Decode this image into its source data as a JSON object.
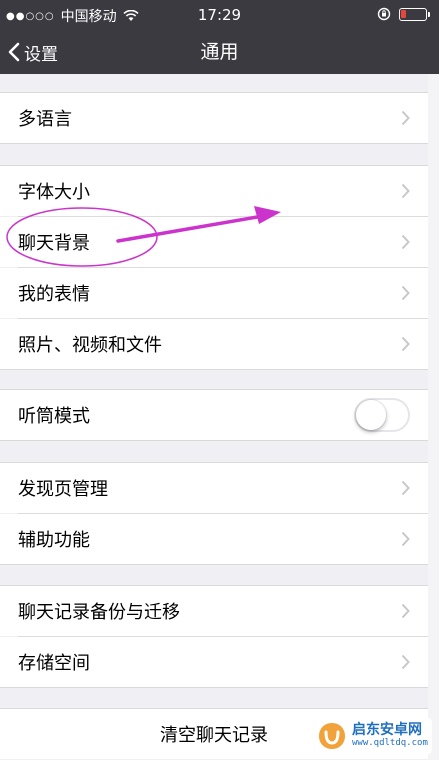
{
  "status_bar": {
    "signal": "●●○○○",
    "carrier": "中国移动",
    "time": "17:29"
  },
  "nav": {
    "back_label": "设置",
    "title": "通用"
  },
  "rows": [
    {
      "label": "多语言"
    },
    {
      "label": "字体大小"
    },
    {
      "label": "聊天背景"
    },
    {
      "label": "我的表情"
    },
    {
      "label": "照片、视频和文件"
    },
    {
      "label": "听筒模式",
      "toggle": false
    },
    {
      "label": "发现页管理"
    },
    {
      "label": "辅助功能"
    },
    {
      "label": "聊天记录备份与迁移"
    },
    {
      "label": "存储空间"
    }
  ],
  "clear_button": "清空聊天记录",
  "watermark": {
    "name": "启东安卓网",
    "url": "www.qdltdq.com"
  },
  "colors": {
    "nav_bg": "#3b3a40",
    "page_bg": "#efeff4",
    "annotation": "#cc33cc",
    "battery_low": "#e8453c"
  }
}
